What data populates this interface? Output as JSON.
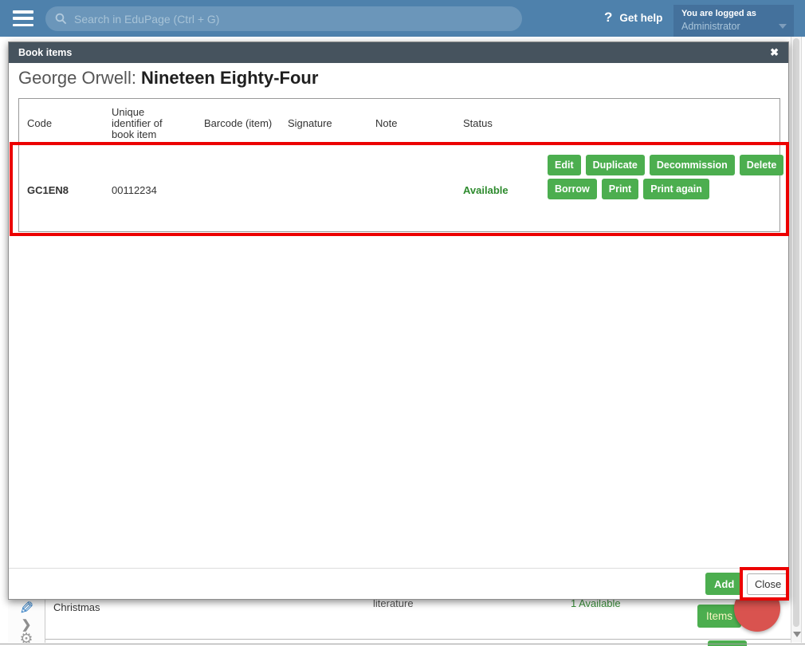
{
  "topbar": {
    "search_placeholder": "Search in EduPage (Ctrl + G)",
    "help_q": "?",
    "get_help": "Get help",
    "logged_as": "You are logged as",
    "user": "Administrator"
  },
  "modal": {
    "header": "Book items",
    "close_x": "✖",
    "title_author": "George Orwell:",
    "title_book": "Nineteen Eighty-Four",
    "table": {
      "columns": [
        "Code",
        "Unique identifier of book item",
        "Barcode (item)",
        "Signature",
        "Note",
        "Status"
      ],
      "rows": [
        {
          "code": "GC1EN8",
          "unique_id": "00112234",
          "barcode": "",
          "signature": "",
          "note": "",
          "status": "Available",
          "actions_row1": [
            "Edit",
            "Duplicate",
            "Decommission",
            "Delete"
          ],
          "actions_row2": [
            "Borrow",
            "Print",
            "Print again"
          ]
        }
      ]
    },
    "footer": {
      "add": "Add",
      "close": "Close"
    }
  },
  "background": {
    "row_title": "Christmas",
    "row_genre": "literature",
    "row_status": "1 Available",
    "items_button": "Items"
  },
  "colors": {
    "topbar_blue": "#4e81ac",
    "button_green": "#4cae4f",
    "status_green": "#2e8b2e",
    "annotation_red": "#ec0000",
    "modal_header": "#46535e",
    "fab_red": "#d9534f"
  }
}
